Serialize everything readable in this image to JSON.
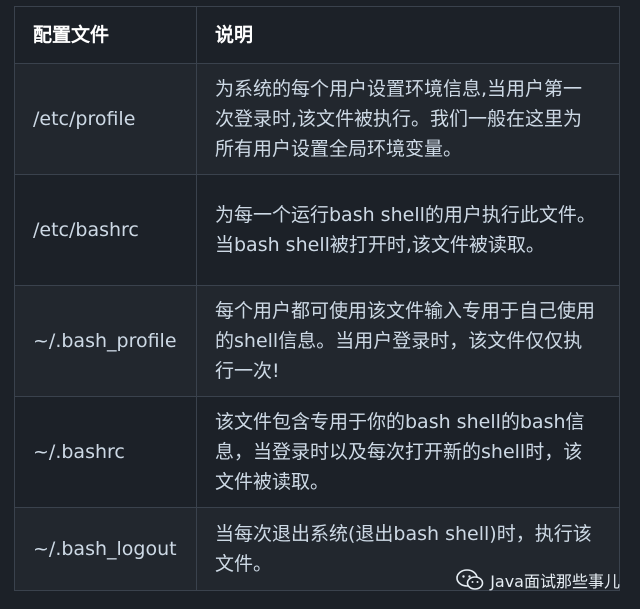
{
  "table": {
    "headers": [
      "配置文件",
      "说明"
    ],
    "rows": [
      {
        "file": "/etc/profile",
        "desc": "为系统的每个用户设置环境信息,当用户第一次登录时,该文件被执行。我们一般在这里为所有用户设置全局环境变量。"
      },
      {
        "file": "/etc/bashrc",
        "desc": "为每一个运行bash shell的用户执行此文件。当bash shell被打开时,该文件被读取。"
      },
      {
        "file": "~/.bash_profile",
        "desc": "每个用户都可使用该文件输入专用于自己使用的shell信息。当用户登录时，该文件仅仅执行一次!"
      },
      {
        "file": "~/.bashrc",
        "desc": "该文件包含专用于你的bash shell的bash信息，当登录时以及每次打开新的shell时，该文件被读取。"
      },
      {
        "file": "~/.bash_logout",
        "desc": "当每次退出系统(退出bash shell)时，执行该文件。"
      }
    ]
  },
  "watermark": {
    "text": "Java面试那些事儿",
    "icon": "wechat-icon"
  }
}
